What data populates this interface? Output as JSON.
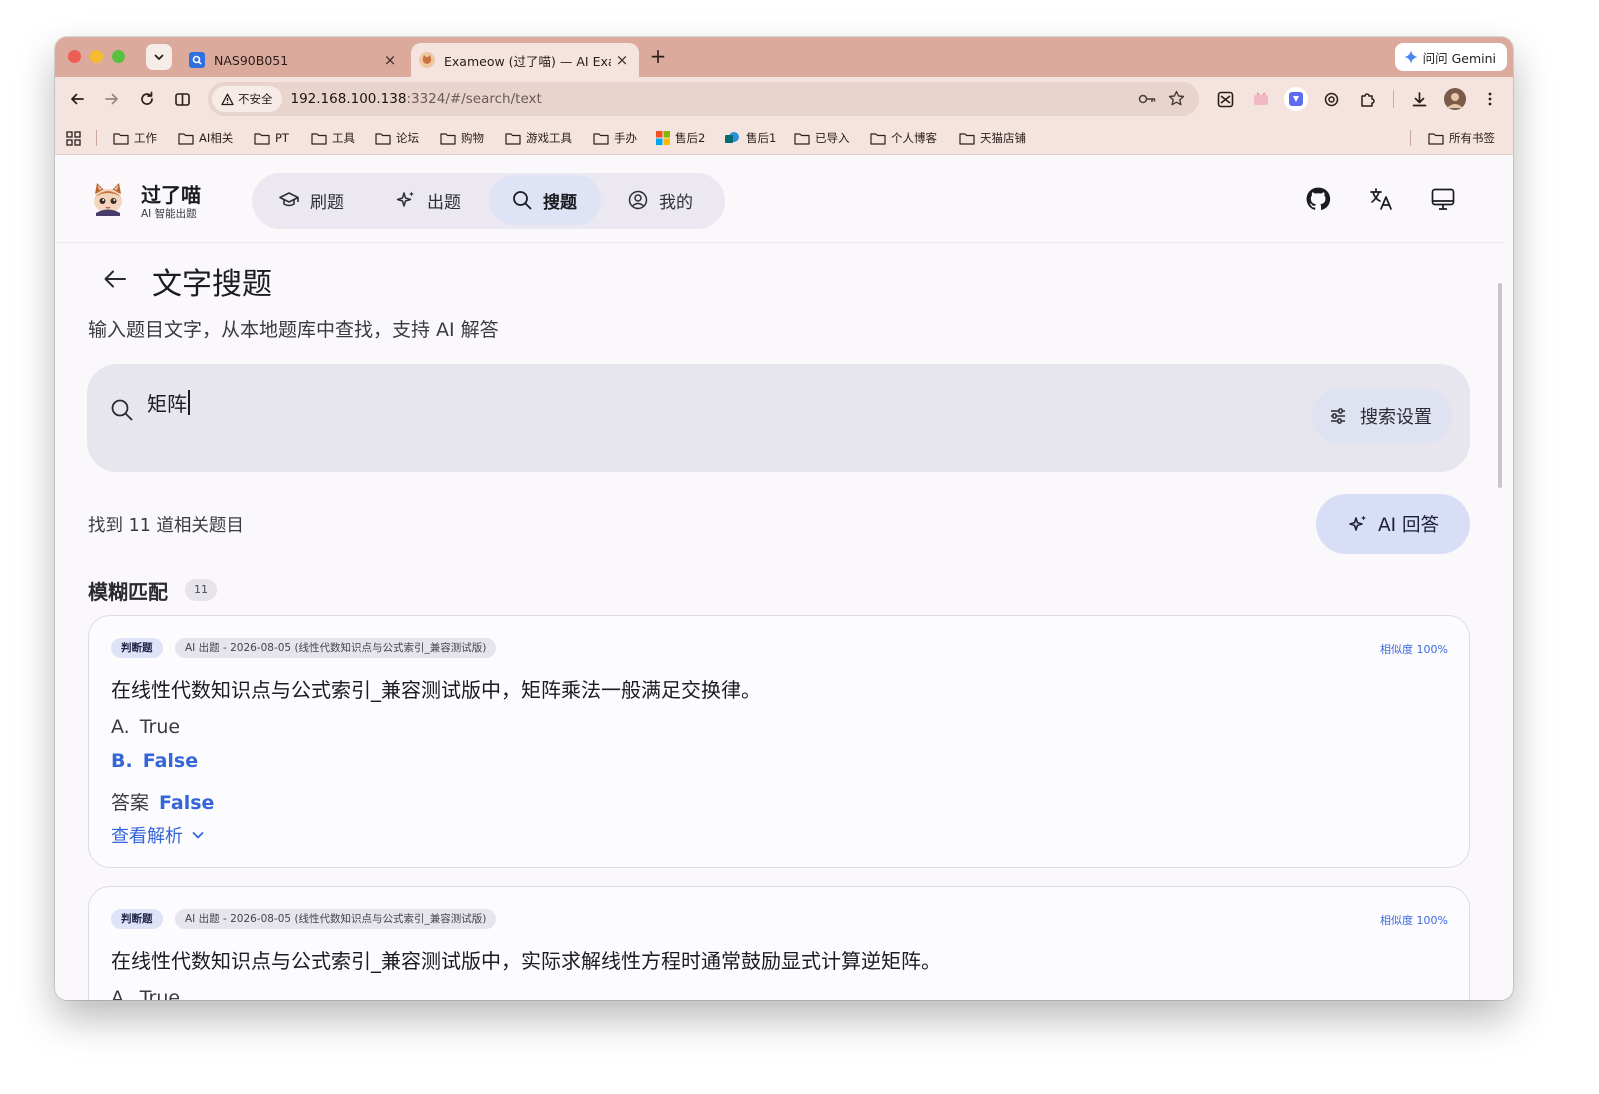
{
  "browser": {
    "tabs": [
      {
        "title": "NAS90B051",
        "close": "×"
      },
      {
        "title": "Exameow (过了喵) — AI Exam",
        "close": "×"
      }
    ],
    "new_tab": "+",
    "gemini_label": "问问 Gemini",
    "security_label": "不安全",
    "url_host": "192.168.100.138",
    "url_rest": ":3324/#/search/text",
    "bookmarks": [
      "工作",
      "AI相关",
      "PT",
      "工具",
      "论坛",
      "购物",
      "游戏工具",
      "手办",
      "售后2",
      "售后1",
      "已导入",
      "个人博客",
      "天猫店铺"
    ],
    "all_bookmarks": "所有书签"
  },
  "app": {
    "brand_name": "过了喵",
    "brand_sub": "AI 智能出题",
    "nav": [
      {
        "label": "刷题",
        "icon": "graduation-cap-icon"
      },
      {
        "label": "出题",
        "icon": "sparkles-icon"
      },
      {
        "label": "搜题",
        "icon": "search-icon",
        "active": true
      },
      {
        "label": "我的",
        "icon": "user-circle-icon"
      }
    ],
    "top_icons": [
      "github-icon",
      "translate-icon",
      "monitor-icon"
    ]
  },
  "page": {
    "title": "文字搜题",
    "description": "输入题目文字，从本地题库中查找，支持 AI 解答",
    "search_value": "矩阵",
    "search_settings": "搜索设置",
    "result_count": "找到 11 道相关题目",
    "ai_answer": "AI 回答",
    "section_title": "模糊匹配",
    "section_count": "11"
  },
  "results": [
    {
      "type": "判断题",
      "source": "AI 出题 - 2026-08-05 (线性代数知识点与公式索引_兼容测试版)",
      "similarity": "相似度 100%",
      "question": "在线性代数知识点与公式索引_兼容测试版中，矩阵乘法一般满足交换律。",
      "options": [
        {
          "key": "A.",
          "text": "True",
          "correct": false
        },
        {
          "key": "B.",
          "text": "False",
          "correct": true
        }
      ],
      "answer_label": "答案",
      "answer": "False",
      "explain": "查看解析"
    },
    {
      "type": "判断题",
      "source": "AI 出题 - 2026-08-05 (线性代数知识点与公式索引_兼容测试版)",
      "similarity": "相似度 100%",
      "question": "在线性代数知识点与公式索引_兼容测试版中，实际求解线性方程时通常鼓励显式计算逆矩阵。",
      "options": [
        {
          "key": "A.",
          "text": "True",
          "correct": false
        }
      ]
    }
  ],
  "colors": {
    "tabstrip": "#dbaa9c",
    "toolbar": "#f4e3de",
    "accent": "#3466d8",
    "nav_active": "#dfe3f6"
  }
}
